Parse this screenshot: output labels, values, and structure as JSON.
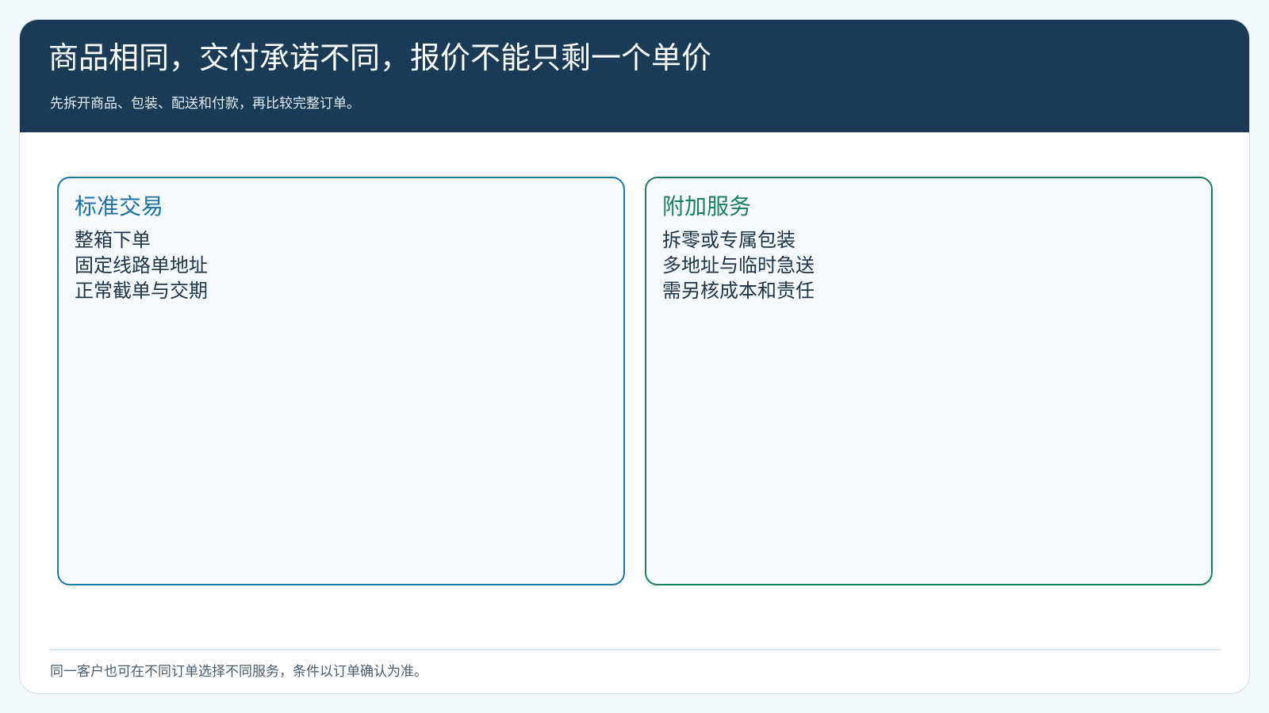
{
  "header": {
    "title": "商品相同，交付承诺不同，报价不能只剩一个单价",
    "subtitle": "先拆开商品、包装、配送和付款，再比较完整订单。"
  },
  "cards": [
    {
      "title": "标准交易",
      "items": [
        "整箱下单",
        "固定线路单地址",
        "正常截单与交期"
      ],
      "color": "#1a72a8"
    },
    {
      "title": "附加服务",
      "items": [
        "拆零或专属包装",
        "多地址与临时急送",
        "需另核成本和责任"
      ],
      "color": "#1a8060"
    }
  ],
  "footer": {
    "note": "同一客户也可在不同订单选择不同服务，条件以订单确认为准。"
  },
  "colors": {
    "header_bg": "#1a3a55",
    "page_bg": "#f3f8fb"
  }
}
